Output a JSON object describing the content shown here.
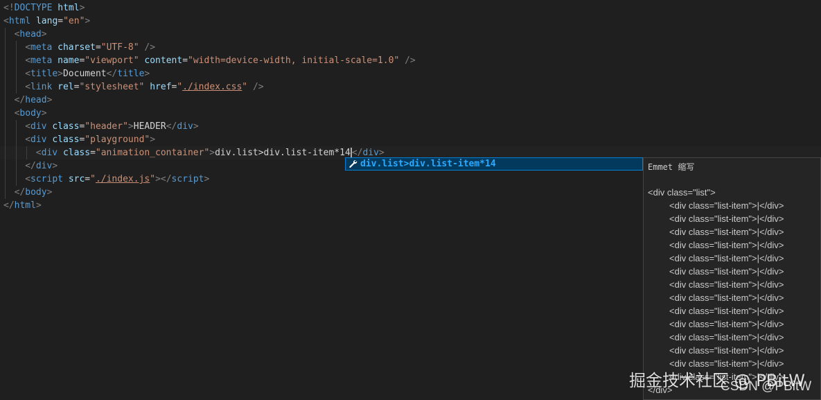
{
  "editor": {
    "lines": [
      {
        "parts": [
          {
            "t": "punct",
            "v": "<!"
          },
          {
            "t": "tag",
            "v": "DOCTYPE"
          },
          {
            "t": "text",
            "v": " "
          },
          {
            "t": "attr",
            "v": "html"
          },
          {
            "t": "punct",
            "v": ">"
          }
        ]
      },
      {
        "parts": [
          {
            "t": "punct",
            "v": "<"
          },
          {
            "t": "tag",
            "v": "html"
          },
          {
            "t": "text",
            "v": " "
          },
          {
            "t": "attr",
            "v": "lang"
          },
          {
            "t": "text",
            "v": "="
          },
          {
            "t": "str",
            "v": "\"en\""
          },
          {
            "t": "punct",
            "v": ">"
          }
        ]
      },
      {
        "parts": [
          {
            "t": "punct",
            "v": "<"
          },
          {
            "t": "tag",
            "v": "head"
          },
          {
            "t": "punct",
            "v": ">"
          }
        ]
      },
      {
        "parts": [
          {
            "t": "punct",
            "v": "<"
          },
          {
            "t": "tag",
            "v": "meta"
          },
          {
            "t": "text",
            "v": " "
          },
          {
            "t": "attr",
            "v": "charset"
          },
          {
            "t": "text",
            "v": "="
          },
          {
            "t": "str",
            "v": "\"UTF-8\""
          },
          {
            "t": "text",
            "v": " "
          },
          {
            "t": "punct",
            "v": "/>"
          }
        ]
      },
      {
        "parts": [
          {
            "t": "punct",
            "v": "<"
          },
          {
            "t": "tag",
            "v": "meta"
          },
          {
            "t": "text",
            "v": " "
          },
          {
            "t": "attr",
            "v": "name"
          },
          {
            "t": "text",
            "v": "="
          },
          {
            "t": "str",
            "v": "\"viewport\""
          },
          {
            "t": "text",
            "v": " "
          },
          {
            "t": "attr",
            "v": "content"
          },
          {
            "t": "text",
            "v": "="
          },
          {
            "t": "str",
            "v": "\"width=device-width, initial-scale=1.0\""
          },
          {
            "t": "text",
            "v": " "
          },
          {
            "t": "punct",
            "v": "/>"
          }
        ]
      },
      {
        "parts": [
          {
            "t": "punct",
            "v": "<"
          },
          {
            "t": "tag",
            "v": "title"
          },
          {
            "t": "punct",
            "v": ">"
          },
          {
            "t": "text",
            "v": "Document"
          },
          {
            "t": "punct",
            "v": "</"
          },
          {
            "t": "tag",
            "v": "title"
          },
          {
            "t": "punct",
            "v": ">"
          }
        ]
      },
      {
        "parts": [
          {
            "t": "punct",
            "v": "<"
          },
          {
            "t": "tag",
            "v": "link"
          },
          {
            "t": "text",
            "v": " "
          },
          {
            "t": "attr",
            "v": "rel"
          },
          {
            "t": "text",
            "v": "="
          },
          {
            "t": "str",
            "v": "\"stylesheet\""
          },
          {
            "t": "text",
            "v": " "
          },
          {
            "t": "attr",
            "v": "href"
          },
          {
            "t": "text",
            "v": "="
          },
          {
            "t": "str",
            "v": "\""
          },
          {
            "t": "strlink",
            "v": "./index.css"
          },
          {
            "t": "str",
            "v": "\""
          },
          {
            "t": "text",
            "v": " "
          },
          {
            "t": "punct",
            "v": "/>"
          }
        ]
      },
      {
        "parts": [
          {
            "t": "punct",
            "v": "</"
          },
          {
            "t": "tag",
            "v": "head"
          },
          {
            "t": "punct",
            "v": ">"
          }
        ]
      },
      {
        "parts": [
          {
            "t": "punct",
            "v": "<"
          },
          {
            "t": "tag",
            "v": "body"
          },
          {
            "t": "punct",
            "v": ">"
          }
        ]
      },
      {
        "parts": [
          {
            "t": "punct",
            "v": "<"
          },
          {
            "t": "tag",
            "v": "div"
          },
          {
            "t": "text",
            "v": " "
          },
          {
            "t": "attr",
            "v": "class"
          },
          {
            "t": "text",
            "v": "="
          },
          {
            "t": "str",
            "v": "\"header\""
          },
          {
            "t": "punct",
            "v": ">"
          },
          {
            "t": "text",
            "v": "HEADER"
          },
          {
            "t": "punct",
            "v": "</"
          },
          {
            "t": "tag",
            "v": "div"
          },
          {
            "t": "punct",
            "v": ">"
          }
        ]
      },
      {
        "parts": [
          {
            "t": "punct",
            "v": "<"
          },
          {
            "t": "tag",
            "v": "div"
          },
          {
            "t": "text",
            "v": " "
          },
          {
            "t": "attr",
            "v": "class"
          },
          {
            "t": "text",
            "v": "="
          },
          {
            "t": "str",
            "v": "\"playground\""
          },
          {
            "t": "punct",
            "v": ">"
          }
        ]
      },
      {
        "parts": [
          {
            "t": "punct",
            "v": "<"
          },
          {
            "t": "tag",
            "v": "div"
          },
          {
            "t": "text",
            "v": " "
          },
          {
            "t": "attr",
            "v": "class"
          },
          {
            "t": "text",
            "v": "="
          },
          {
            "t": "str",
            "v": "\"animation_container\""
          },
          {
            "t": "punct",
            "v": ">"
          },
          {
            "t": "text",
            "v": "div.list>div.list-item*14"
          },
          {
            "t": "cursor",
            "v": ""
          },
          {
            "t": "punct",
            "v": "</"
          },
          {
            "t": "tag",
            "v": "div"
          },
          {
            "t": "punct",
            "v": ">"
          }
        ]
      },
      {
        "parts": [
          {
            "t": "punct",
            "v": "</"
          },
          {
            "t": "tag",
            "v": "div"
          },
          {
            "t": "punct",
            "v": ">"
          }
        ]
      },
      {
        "parts": [
          {
            "t": "punct",
            "v": "<"
          },
          {
            "t": "tag",
            "v": "script"
          },
          {
            "t": "text",
            "v": " "
          },
          {
            "t": "attr",
            "v": "src"
          },
          {
            "t": "text",
            "v": "="
          },
          {
            "t": "str",
            "v": "\""
          },
          {
            "t": "strlink",
            "v": "./index.js"
          },
          {
            "t": "str",
            "v": "\""
          },
          {
            "t": "punct",
            "v": "></"
          },
          {
            "t": "tag",
            "v": "script"
          },
          {
            "t": "punct",
            "v": ">"
          }
        ]
      },
      {
        "parts": [
          {
            "t": "punct",
            "v": "</"
          },
          {
            "t": "tag",
            "v": "body"
          },
          {
            "t": "punct",
            "v": ">"
          }
        ]
      },
      {
        "parts": [
          {
            "t": "punct",
            "v": "</"
          },
          {
            "t": "tag",
            "v": "html"
          },
          {
            "t": "punct",
            "v": ">"
          }
        ]
      }
    ]
  },
  "suggest": {
    "icon": "wrench-icon",
    "label": "div.list>div.list-item*14"
  },
  "details": {
    "title": "Emmet 缩写",
    "open_line": "<div class=\"list\">",
    "item_line": "<div class=\"list-item\">|</div>",
    "item_count": 14,
    "close_line": "</div>"
  },
  "watermark": {
    "main": "掘金技术社区 @ PBitW",
    "csdn": "CSDN @PBitW"
  },
  "colors": {
    "background": "#1f1f1f",
    "tag": "#569cd6",
    "attribute": "#9cdcfe",
    "string": "#ce9178",
    "punctuation": "#808080",
    "text": "#d4d4d4",
    "suggest_highlight": "#2aaaff",
    "suggest_background": "#04395e"
  }
}
